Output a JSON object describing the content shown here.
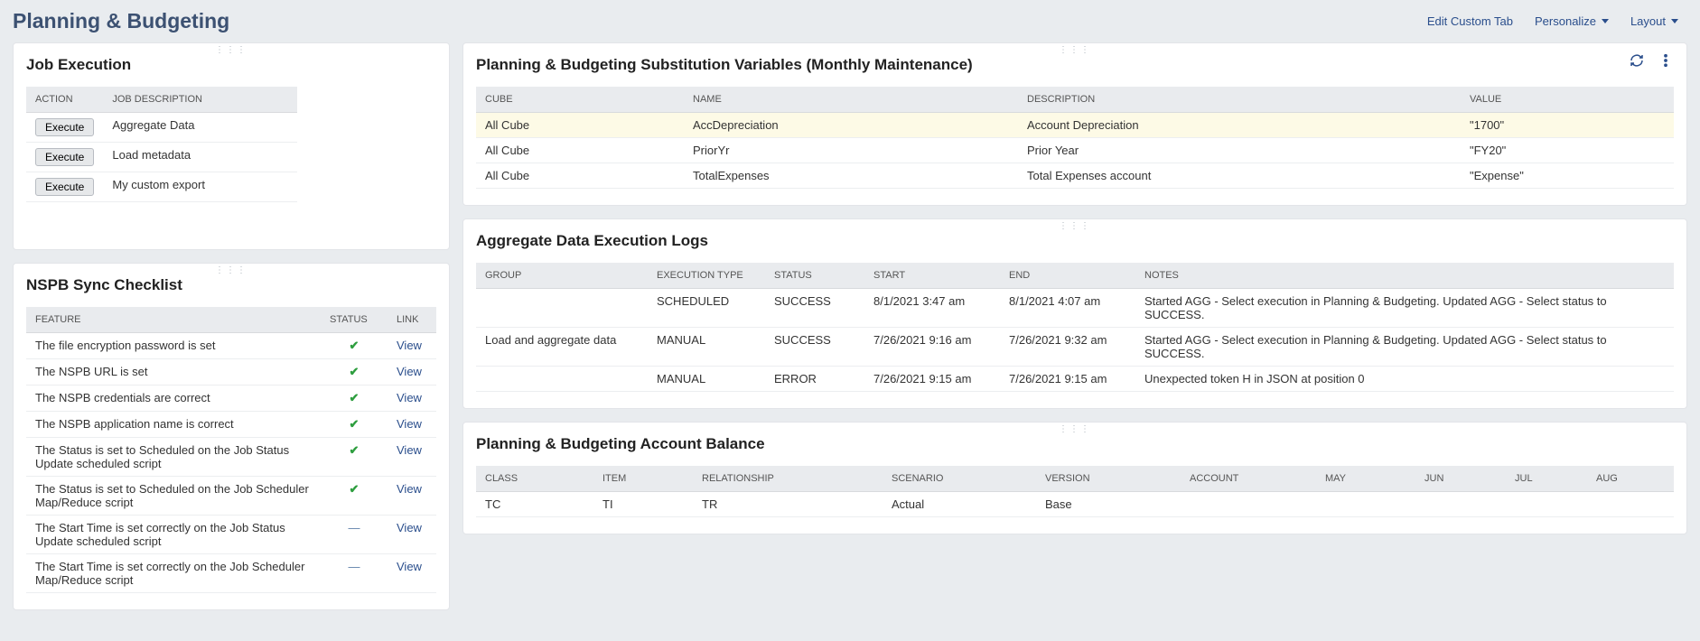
{
  "header": {
    "title": "Planning & Budgeting",
    "edit_tab": "Edit Custom Tab",
    "personalize": "Personalize",
    "layout": "Layout"
  },
  "job_execution": {
    "title": "Job Execution",
    "cols": {
      "action": "ACTION",
      "desc": "JOB DESCRIPTION"
    },
    "rows": [
      {
        "btn": "Execute",
        "desc": "Aggregate Data"
      },
      {
        "btn": "Execute",
        "desc": "Load metadata"
      },
      {
        "btn": "Execute",
        "desc": "My custom export"
      }
    ]
  },
  "checklist": {
    "title": "NSPB Sync Checklist",
    "cols": {
      "feature": "FEATURE",
      "status": "STATUS",
      "link": "LINK"
    },
    "rows": [
      {
        "feature": "The file encryption password is set",
        "status": "check",
        "link": "View"
      },
      {
        "feature": "The NSPB URL is set",
        "status": "check",
        "link": "View"
      },
      {
        "feature": "The NSPB credentials are correct",
        "status": "check",
        "link": "View"
      },
      {
        "feature": "The NSPB application name is correct",
        "status": "check",
        "link": "View"
      },
      {
        "feature": "The Status is set to Scheduled on the Job Status Update scheduled script",
        "status": "check",
        "link": "View"
      },
      {
        "feature": "The Status is set to Scheduled on the Job Scheduler Map/Reduce script",
        "status": "check",
        "link": "View"
      },
      {
        "feature": "The Start Time is set correctly on the Job Status Update scheduled script",
        "status": "dash",
        "link": "View"
      },
      {
        "feature": "The Start Time is set correctly on the Job Scheduler Map/Reduce script",
        "status": "dash",
        "link": "View"
      }
    ]
  },
  "substitution": {
    "title": "Planning & Budgeting Substitution Variables (Monthly Maintenance)",
    "cols": {
      "cube": "CUBE",
      "name": "NAME",
      "desc": "DESCRIPTION",
      "value": "VALUE"
    },
    "rows": [
      {
        "cube": "All Cube",
        "name": "AccDepreciation",
        "desc": "Account Depreciation",
        "value": "\"1700\""
      },
      {
        "cube": "All Cube",
        "name": "PriorYr",
        "desc": "Prior Year",
        "value": "\"FY20\""
      },
      {
        "cube": "All Cube",
        "name": "TotalExpenses",
        "desc": "Total Expenses account",
        "value": "\"Expense\""
      }
    ]
  },
  "logs": {
    "title": "Aggregate Data Execution Logs",
    "cols": {
      "group": "GROUP",
      "type": "EXECUTION TYPE",
      "status": "STATUS",
      "start": "START",
      "end": "END",
      "notes": "NOTES"
    },
    "rows": [
      {
        "group": "",
        "type": "SCHEDULED",
        "status": "SUCCESS",
        "start": "8/1/2021 3:47 am",
        "end": "8/1/2021 4:07 am",
        "notes": "Started AGG - Select execution in Planning & Budgeting. Updated AGG - Select status to SUCCESS."
      },
      {
        "group": "Load and aggregate data",
        "type": "MANUAL",
        "status": "SUCCESS",
        "start": "7/26/2021 9:16 am",
        "end": "7/26/2021 9:32 am",
        "notes": "Started AGG - Select execution in Planning & Budgeting. Updated AGG - Select status to SUCCESS."
      },
      {
        "group": "",
        "type": "MANUAL",
        "status": "ERROR",
        "start": "7/26/2021 9:15 am",
        "end": "7/26/2021 9:15 am",
        "notes": "Unexpected token H in JSON at position 0"
      }
    ]
  },
  "balance": {
    "title": "Planning & Budgeting Account Balance",
    "cols": {
      "class": "CLASS",
      "item": "ITEM",
      "rel": "RELATIONSHIP",
      "scen": "SCENARIO",
      "ver": "VERSION",
      "acct": "ACCOUNT",
      "may": "MAY",
      "jun": "JUN",
      "jul": "JUL",
      "aug": "AUG"
    },
    "rows": [
      {
        "class": "TC",
        "item": "TI",
        "rel": "TR",
        "scen": "Actual",
        "ver": "Base",
        "acct": "",
        "may": "",
        "jun": "",
        "jul": "",
        "aug": ""
      }
    ]
  }
}
